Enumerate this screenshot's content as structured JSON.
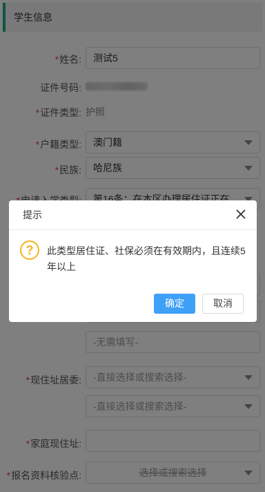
{
  "section": {
    "title": "学生信息"
  },
  "fields": {
    "name": {
      "label": "姓名:",
      "value": "测试5"
    },
    "id_number": {
      "label": "证件号码:"
    },
    "id_type": {
      "label": "证件类型:",
      "value": "护照"
    },
    "household_type": {
      "label": "户籍类型:",
      "value": "澳门籍"
    },
    "ethnicity": {
      "label": "民族:",
      "value": "哈尼族"
    },
    "application_category": {
      "label": "申请入学类型:",
      "value": "第16条：在本区办理居住证正在..."
    },
    "no_need_fill": {
      "value": "-无需填写-"
    },
    "current_committee": {
      "label": "现住址居委:",
      "placeholder": "-直接选择或搜索选择-"
    },
    "current_committee_2": {
      "placeholder": "-直接选择或搜索选择-"
    },
    "home_address": {
      "label": "家庭现住址:",
      "value": ""
    },
    "registration_verification": {
      "label": "报名资料核验点:",
      "placeholder": "选择或搜索选择"
    }
  },
  "dialog": {
    "title": "提示",
    "message": "此类型居住证、社保必须在有效期内，且连续5年以上",
    "confirm_label": "确定",
    "cancel_label": "取消"
  },
  "colors": {
    "accent": "#1aaa8c",
    "primary_button": "#3ea0f7",
    "warning": "#f5b51f",
    "required": "#e03d3d"
  },
  "icons": [
    "close-icon",
    "warning-icon",
    "chevron-down-icon"
  ]
}
